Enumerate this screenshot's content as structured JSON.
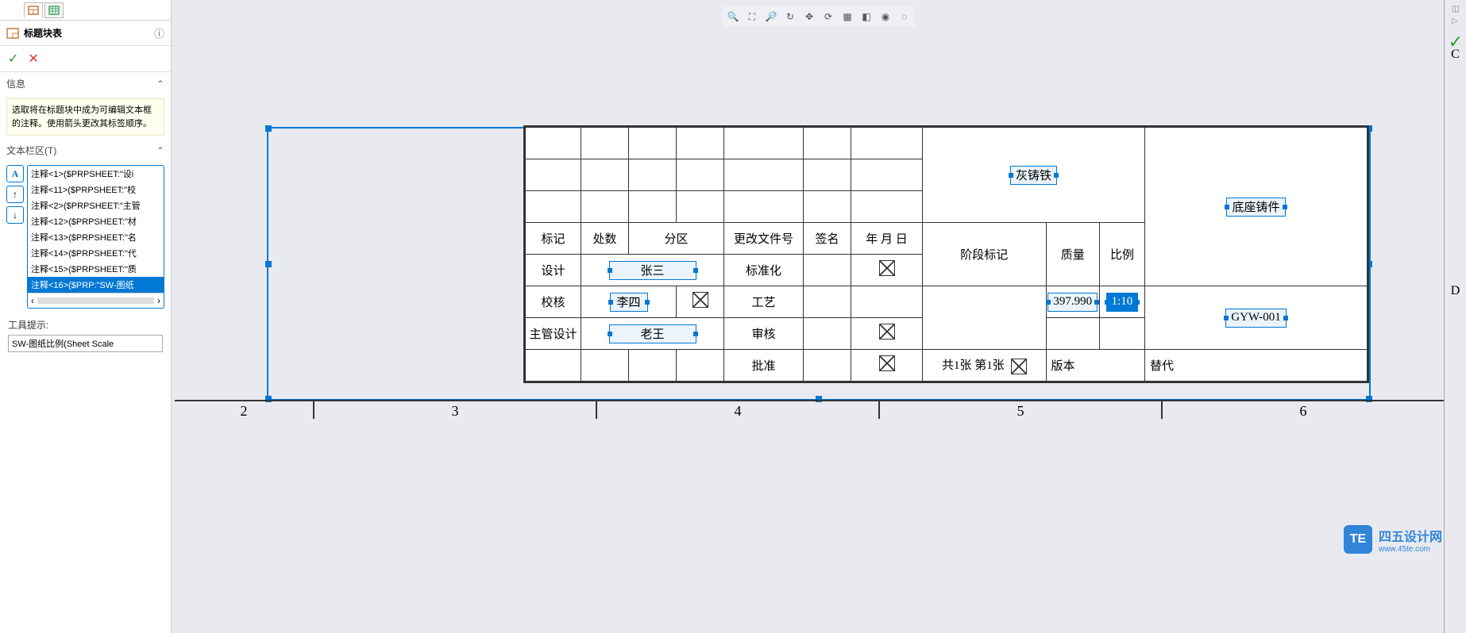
{
  "panel": {
    "title": "标题块表",
    "info_header": "信息",
    "info_text": "选取将在标题块中成为可编辑文本框的注释。使用箭头更改其标签顺序。",
    "textfields_header": "文本栏区(T)",
    "tooltip_label": "工具提示:",
    "tooltip_value": "SW-图纸比例(Sheet Scale",
    "items": [
      "注释<1>($PRPSHEET:\"设i",
      "注释<11>($PRPSHEET:\"校",
      "注释<2>($PRPSHEET:\"主管",
      "注释<12>($PRPSHEET:\"材",
      "注释<13>($PRPSHEET:\"名",
      "注释<14>($PRPSHEET:\"代",
      "注释<15>($PRPSHEET:\"质",
      "注释<16>($PRP:\"SW-图纸"
    ],
    "selected_index": 7
  },
  "ruler": {
    "labels": [
      "2",
      "3",
      "4",
      "5",
      "6"
    ]
  },
  "right_letters": {
    "c": "C",
    "d": "D"
  },
  "title_block": {
    "material": "灰铸铁",
    "stage_mark": "阶段标记",
    "mass_label": "质量",
    "scale_label": "比例",
    "part_name": "底座铸件",
    "mark": "标记",
    "places": "处数",
    "zone": "分区",
    "change_doc": "更改文件号",
    "signature": "签名",
    "date": "年 月 日",
    "design": "设计",
    "designer": "张三",
    "standardize": "标准化",
    "mass_value": "397.990",
    "scale_value": "1:10",
    "check": "校核",
    "checker": "李四",
    "process": "工艺",
    "chief_design": "主管设计",
    "chief": "老王",
    "review": "审核",
    "drawing_no": "GYW-001",
    "approve": "批准",
    "sheet_info": "共1张    第1张",
    "version": "版本",
    "substitute": "替代"
  },
  "watermark": {
    "badge": "TE",
    "text": "四五设计网",
    "sub": "www.45te.com"
  }
}
